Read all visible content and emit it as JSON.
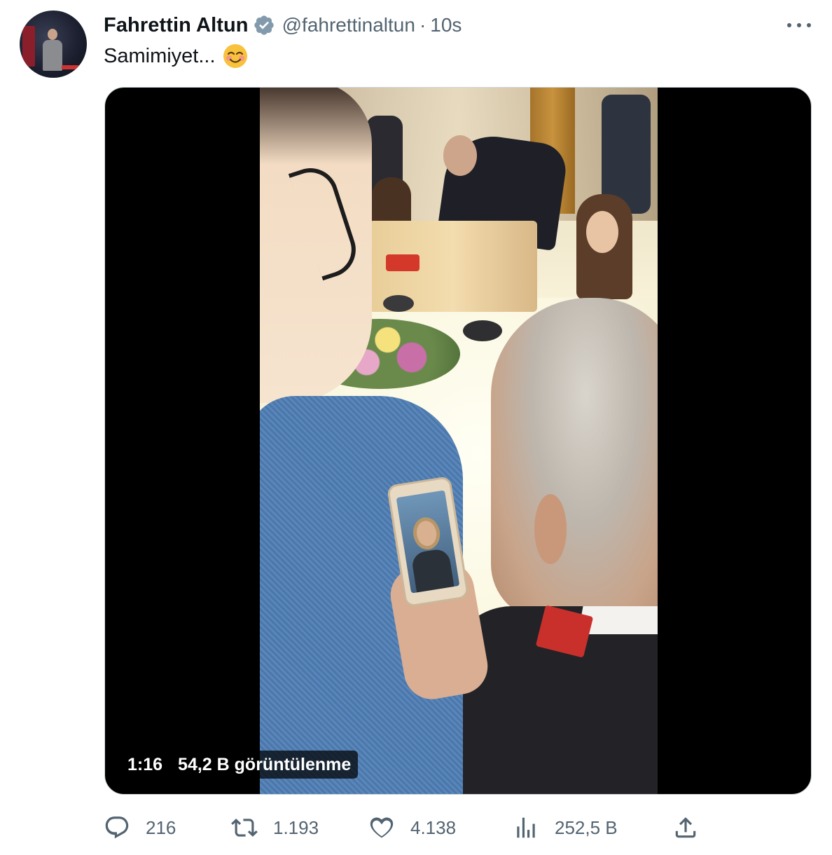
{
  "tweet": {
    "author_name": "Fahrettin Altun",
    "handle": "@fahrettinaltun",
    "separator": "·",
    "time": "10s",
    "text": "Samimiyet...",
    "emoji": "smiling-face-with-smiling-eyes"
  },
  "video": {
    "duration": "1:16",
    "views": "54,2 B görüntülenme"
  },
  "actions": {
    "replies": "216",
    "retweets": "1.193",
    "likes": "4.138",
    "views": "252,5 B"
  },
  "colors": {
    "text": "#0f1419",
    "secondary": "#536471",
    "verified": "#829aab",
    "media_bg": "#000000"
  },
  "icons": [
    "verified-badge-icon",
    "more-options-icon",
    "reply-icon",
    "retweet-icon",
    "like-icon",
    "analytics-icon",
    "share-icon"
  ]
}
